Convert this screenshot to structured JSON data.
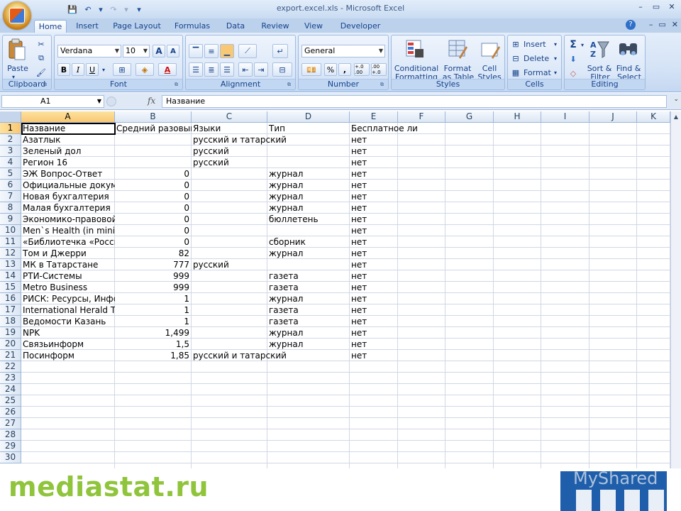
{
  "window": {
    "title": "export.excel.xls - Microsoft Excel",
    "controls": [
      "–",
      "▭",
      "✕"
    ],
    "doc_controls": [
      "–",
      "▭",
      "✕"
    ]
  },
  "quick_access": {
    "save": "💾",
    "undo": "↶",
    "undo_dropdown": "▾",
    "redo": "↷",
    "redo_dropdown": "▾",
    "customize": "▾"
  },
  "ribbon": {
    "tabs": [
      "Home",
      "Insert",
      "Page Layout",
      "Formulas",
      "Data",
      "Review",
      "View",
      "Developer"
    ],
    "active_tab": "Home",
    "help": "?",
    "groups": {
      "clipboard": {
        "label": "Clipboard",
        "paste": "Paste"
      },
      "font": {
        "label": "Font",
        "font_name": "Verdana",
        "font_size": "10",
        "grow": "A",
        "shrink": "A",
        "bold": "B",
        "italic": "I",
        "underline": "U",
        "font_color": "A"
      },
      "alignment": {
        "label": "Alignment"
      },
      "number": {
        "label": "Number",
        "format": "General",
        "percent": "%",
        "comma": ",",
        "inc_decimal": "+.0 .00",
        "dec_decimal": ".00 +.0"
      },
      "styles": {
        "label": "Styles",
        "conditional": "Conditional",
        "conditional2": "Formatting",
        "format_as": "Format",
        "format_as2": "as Table",
        "cell": "Cell",
        "cell2": "Styles"
      },
      "cells": {
        "label": "Cells",
        "insert": "Insert",
        "delete": "Delete",
        "format": "Format"
      },
      "editing": {
        "label": "Editing",
        "sort": "Sort &",
        "sort2": "Filter",
        "find": "Find &",
        "find2": "Select",
        "sigma": "Σ"
      }
    }
  },
  "formula_bar": {
    "name_box": "A1",
    "fx": "fx",
    "content": "Название"
  },
  "sheet": {
    "columns": [
      "A",
      "B",
      "C",
      "D",
      "E",
      "F",
      "G",
      "H",
      "I",
      "J",
      "K"
    ],
    "selected_column": "A",
    "selected_row": "1",
    "rows": [
      [
        "Название",
        "Средний разовый",
        "Языки",
        "Тип",
        "Бесплатное ли"
      ],
      [
        "Азатлык",
        "",
        "русский и татарский",
        "",
        "нет"
      ],
      [
        "Зеленый дол",
        "",
        "русский",
        "",
        "нет"
      ],
      [
        "Регион 16",
        "",
        "русский",
        "",
        "нет"
      ],
      [
        "ЭЖ Вопрос-Ответ",
        "0",
        "",
        "журнал",
        "нет"
      ],
      [
        "Официальные документы",
        "0",
        "",
        "журнал",
        "нет"
      ],
      [
        "Новая бухгалтерия",
        "0",
        "",
        "журнал",
        "нет"
      ],
      [
        "Малая бухгалтерия",
        "0",
        "",
        "журнал",
        "нет"
      ],
      [
        "Экономико-правовой",
        "0",
        "",
        "бюллетень",
        "нет"
      ],
      [
        "Men`s Health (in mini)",
        "0",
        "",
        "",
        "нет"
      ],
      [
        "«Библиотечка «Российской",
        "0",
        "",
        "сборник",
        "нет"
      ],
      [
        "Том и Джерри",
        "82",
        "",
        "журнал",
        "нет"
      ],
      [
        "МК в Татарстане",
        "777",
        "русский",
        "",
        "нет"
      ],
      [
        "РТИ-Системы",
        "999",
        "",
        "газета",
        "нет"
      ],
      [
        "Metro Business",
        "999",
        "",
        "газета",
        "нет"
      ],
      [
        "РИСК: Ресурсы, Информация",
        "1",
        "",
        "журнал",
        "нет"
      ],
      [
        "International Herald Tribune",
        "1",
        "",
        "газета",
        "нет"
      ],
      [
        "Ведомости Казань",
        "1",
        "",
        "газета",
        "нет"
      ],
      [
        "NPK",
        "1,499",
        "",
        "журнал",
        "нет"
      ],
      [
        "Связьинформ",
        "1,5",
        "",
        "журнал",
        "нет"
      ],
      [
        "Посинформ",
        "1,85",
        "русский и татарский",
        "",
        "нет"
      ]
    ],
    "row_numbers": [
      "1",
      "2",
      "3",
      "4",
      "5",
      "6",
      "7",
      "8",
      "9",
      "10",
      "11",
      "12",
      "13",
      "14",
      "15",
      "16",
      "17",
      "18",
      "19",
      "20",
      "21",
      "22",
      "23",
      "24",
      "25",
      "26",
      "27",
      "28",
      "29",
      "30"
    ]
  },
  "watermark": {
    "left": "mediastat.ru",
    "right": "MyShared"
  },
  "colors": {
    "ribbon_bg": "#d5e3f6",
    "header_selected": "#f8c874",
    "watermark_green": "#8fc43b",
    "watermark_blue": "#1f5eaa"
  }
}
